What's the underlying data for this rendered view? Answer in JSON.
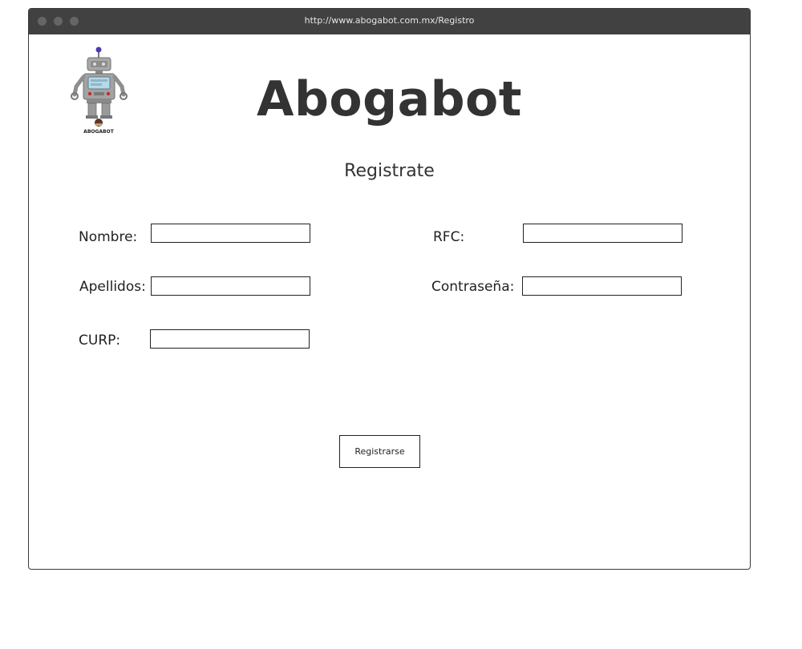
{
  "browser": {
    "url": "http://www.abogabot.com.mx/Registro"
  },
  "header": {
    "title": "Abogabot",
    "logo_text": "ABOGABOT"
  },
  "form": {
    "heading": "Registrate",
    "fields": [
      {
        "label": "Nombre:",
        "value": ""
      },
      {
        "label": "Apellidos:",
        "value": ""
      },
      {
        "label": "CURP:",
        "value": ""
      },
      {
        "label": "RFC:",
        "value": ""
      },
      {
        "label": "Contraseña:",
        "value": ""
      }
    ],
    "submit_label": "Registrarse"
  },
  "colors": {
    "titlebar": "#414141",
    "text": "#333333"
  }
}
